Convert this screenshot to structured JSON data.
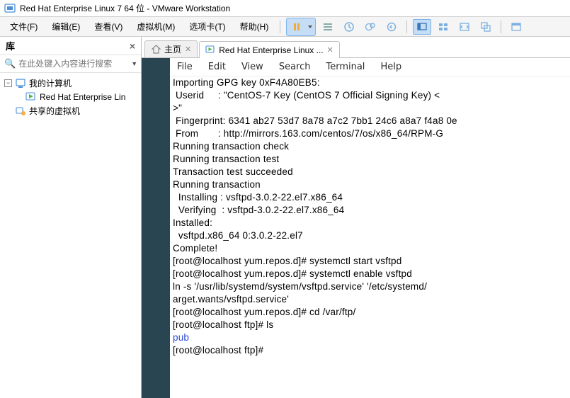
{
  "titlebar": {
    "text": "Red Hat Enterprise Linux 7 64 位 - VMware Workstation"
  },
  "menu": {
    "file": "文件(F)",
    "edit": "编辑(E)",
    "view": "查看(V)",
    "vm": "虚拟机(M)",
    "tabs": "选项卡(T)",
    "help": "帮助(H)"
  },
  "sidebar": {
    "title": "库",
    "search_placeholder": "在此处键入内容进行搜索",
    "root": "我的计算机",
    "items": [
      "Red Hat Enterprise Lin",
      "共享的虚拟机"
    ]
  },
  "tabs": {
    "home": "主页",
    "active": "Red Hat Enterprise Linux ..."
  },
  "term_menu": {
    "file": "File",
    "edit": "Edit",
    "view": "View",
    "search": "Search",
    "terminal": "Terminal",
    "help": "Help"
  },
  "terminal_lines": [
    {
      "t": "Importing GPG key 0xF4A80EB5:"
    },
    {
      "t": " Userid     : \"CentOS-7 Key (CentOS 7 Official Signing Key) <"
    },
    {
      "t": ">\""
    },
    {
      "t": " Fingerprint: 6341 ab27 53d7 8a78 a7c2 7bb1 24c6 a8a7 f4a8 0e"
    },
    {
      "t": " From       : http://mirrors.163.com/centos/7/os/x86_64/RPM-G"
    },
    {
      "t": "Running transaction check"
    },
    {
      "t": "Running transaction test"
    },
    {
      "t": "Transaction test succeeded"
    },
    {
      "t": "Running transaction"
    },
    {
      "t": "  Installing : vsftpd-3.0.2-22.el7.x86_64"
    },
    {
      "t": "  Verifying  : vsftpd-3.0.2-22.el7.x86_64"
    },
    {
      "t": ""
    },
    {
      "t": "Installed:"
    },
    {
      "t": "  vsftpd.x86_64 0:3.0.2-22.el7"
    },
    {
      "t": ""
    },
    {
      "t": "Complete!"
    },
    {
      "t": "[root@localhost yum.repos.d]# systemctl start vsftpd"
    },
    {
      "t": "[root@localhost yum.repos.d]# systemctl enable vsftpd"
    },
    {
      "t": "ln -s '/usr/lib/systemd/system/vsftpd.service' '/etc/systemd/"
    },
    {
      "t": "arget.wants/vsftpd.service'"
    },
    {
      "t": "[root@localhost yum.repos.d]# cd /var/ftp/"
    },
    {
      "t": "[root@localhost ftp]# ls"
    },
    {
      "t": "pub",
      "cls": "link"
    },
    {
      "t": "[root@localhost ftp]# "
    }
  ]
}
